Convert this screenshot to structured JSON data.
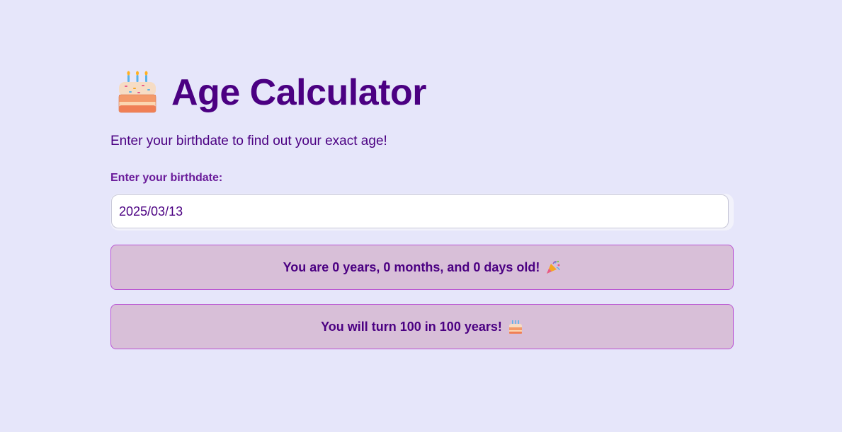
{
  "header": {
    "title": "Age Calculator",
    "title_icon": "birthday-cake-icon",
    "subtitle": "Enter your birthdate to find out your exact age!"
  },
  "form": {
    "birthdate_label": "Enter your birthdate:",
    "birthdate_value": "2025/03/13"
  },
  "results": {
    "age_message": "You are 0 years, 0 months, and 0 days old!",
    "age_icon": "party-popper-icon",
    "hundred_message": "You will turn 100 in 100 years!",
    "hundred_icon": "birthday-cake-icon"
  },
  "colors": {
    "background": "#e6e6fa",
    "title": "#4b0082",
    "label": "#6a1b9a",
    "result_background": "#d8bfd8",
    "result_border": "#ba55d3"
  }
}
